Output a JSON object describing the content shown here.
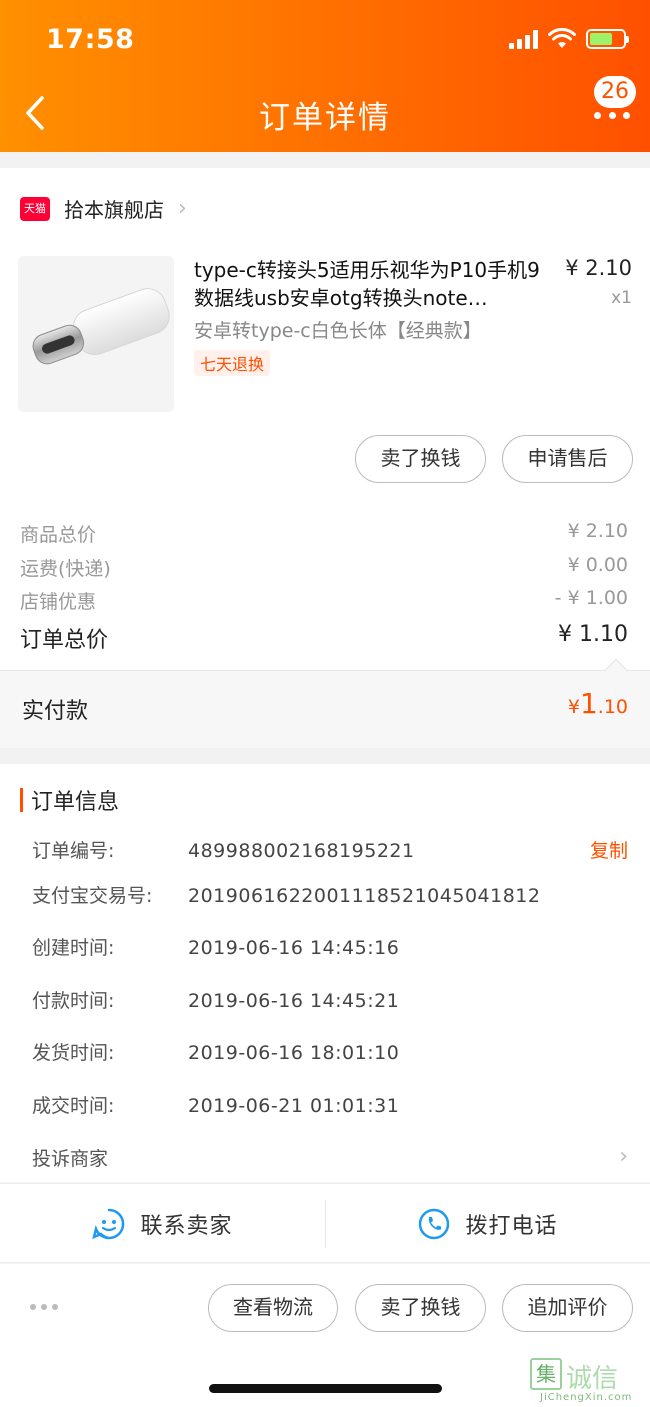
{
  "status": {
    "time": "17:58"
  },
  "header": {
    "title": "订单详情",
    "badge_count": "26"
  },
  "shop": {
    "logo_text": "天猫",
    "name": "拾本旗舰店"
  },
  "product": {
    "title": "type-c转接头5适用乐视华为P10手机9数据线usb安卓otg转换头note…",
    "sku": "安卓转type-c白色长体【经典款】",
    "tag": "七天退换",
    "price": "¥ 2.10",
    "qty": "x1"
  },
  "product_actions": {
    "sell": "卖了换钱",
    "after_sale": "申请售后"
  },
  "fees": [
    {
      "label": "商品总价",
      "value": "¥ 2.10"
    },
    {
      "label": "运费(快递)",
      "value": "¥ 0.00"
    },
    {
      "label": "店铺优惠",
      "value": "- ¥ 1.00"
    },
    {
      "label": "订单总价",
      "value": "¥ 1.10"
    }
  ],
  "paid": {
    "label": "实付款",
    "currency": "¥",
    "int": "1",
    "dec": ".10"
  },
  "order_info": {
    "title": "订单信息",
    "copy": "复制",
    "rows": [
      {
        "label": "订单编号:",
        "value": "489988002168195221"
      },
      {
        "label": "支付宝交易号:",
        "value": "2019061622001118521045041812"
      },
      {
        "label": "创建时间:",
        "value": "2019-06-16 14:45:16"
      },
      {
        "label": "付款时间:",
        "value": "2019-06-16 14:45:21"
      },
      {
        "label": "发货时间:",
        "value": "2019-06-16 18:01:10"
      },
      {
        "label": "成交时间:",
        "value": "2019-06-21 01:01:31"
      }
    ],
    "complain": "投诉商家"
  },
  "contact": {
    "seller": "联系卖家",
    "call": "拨打电话"
  },
  "bottom_actions": {
    "logistics": "查看物流",
    "sell": "卖了换钱",
    "review": "追加评价"
  },
  "watermark": {
    "text": "诚信",
    "sub": "JiChengXin.com",
    "box": "集"
  },
  "colors": {
    "accent": "#ff5000",
    "header_start": "#ff9000",
    "header_end": "#ff5000",
    "tmall": "#ff0036"
  }
}
